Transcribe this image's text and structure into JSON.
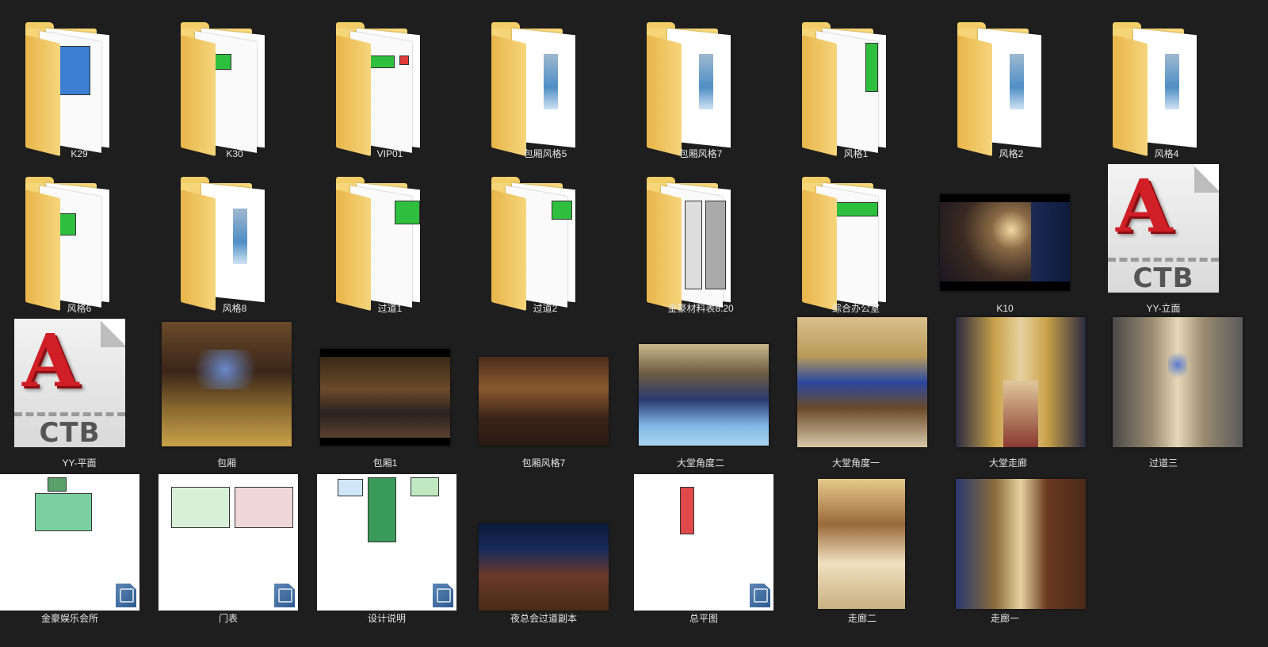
{
  "items": [
    {
      "label": "K29",
      "type": "folder"
    },
    {
      "label": "K30",
      "type": "folder"
    },
    {
      "label": "VIP01",
      "type": "folder"
    },
    {
      "label": "包厢风格5",
      "type": "folder"
    },
    {
      "label": "包厢风格7",
      "type": "folder"
    },
    {
      "label": "风格1",
      "type": "folder"
    },
    {
      "label": "风格2",
      "type": "folder"
    },
    {
      "label": "风格4",
      "type": "folder"
    },
    {
      "label": "风格6",
      "type": "folder"
    },
    {
      "label": "风格8",
      "type": "folder"
    },
    {
      "label": "过道1",
      "type": "folder"
    },
    {
      "label": "过道2",
      "type": "folder"
    },
    {
      "label": "金豪材料表8.20",
      "type": "folder"
    },
    {
      "label": "综合办公室",
      "type": "folder"
    },
    {
      "label": "K10",
      "type": "image"
    },
    {
      "label": "YY-立面",
      "type": "ctb"
    },
    {
      "label": "YY-平面",
      "type": "ctb"
    },
    {
      "label": "包厢",
      "type": "image"
    },
    {
      "label": "包厢1",
      "type": "image"
    },
    {
      "label": "包厢风格7",
      "type": "image"
    },
    {
      "label": "大堂角度二",
      "type": "image"
    },
    {
      "label": "大堂角度一",
      "type": "image"
    },
    {
      "label": "大堂走廊",
      "type": "image"
    },
    {
      "label": "过道三",
      "type": "image"
    },
    {
      "label": "金豪娱乐会所",
      "type": "doc"
    },
    {
      "label": "门表",
      "type": "doc"
    },
    {
      "label": "设计说明",
      "type": "doc"
    },
    {
      "label": "夜总会过道副本",
      "type": "image"
    },
    {
      "label": "总平图",
      "type": "doc"
    },
    {
      "label": "走廊二",
      "type": "image"
    },
    {
      "label": "走廊一",
      "type": "image"
    }
  ],
  "ctb_text": "CTB",
  "ctb_letter": "A"
}
